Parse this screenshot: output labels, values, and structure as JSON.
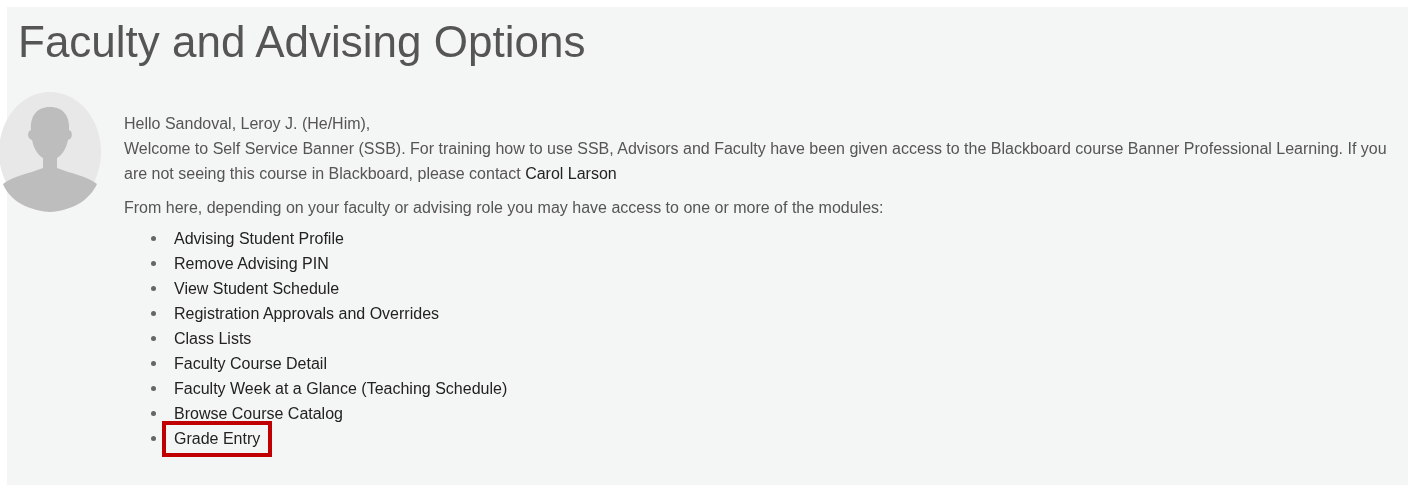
{
  "title": "Faculty and Advising Options",
  "greeting": "Hello Sandoval, Leroy J. (He/Him),",
  "welcome": {
    "text": "Welcome to Self Service Banner (SSB). For training how to use SSB, Advisors and Faculty have been given access to the Blackboard course Banner Professional Learning. If you are not seeing this course in Blackboard, please contact",
    "link": "Carol Larson"
  },
  "intro": "From here, depending on your faculty or advising role you may have access to one or more of the modules:",
  "modules": [
    {
      "label": "Advising Student Profile",
      "highlighted": false
    },
    {
      "label": "Remove Advising PIN",
      "highlighted": false
    },
    {
      "label": "View Student Schedule",
      "highlighted": false
    },
    {
      "label": "Registration Approvals and Overrides",
      "highlighted": false
    },
    {
      "label": "Class Lists",
      "highlighted": false
    },
    {
      "label": "Faculty Course Detail",
      "highlighted": false
    },
    {
      "label": "Faculty Week at a Glance (Teaching Schedule)",
      "highlighted": false
    },
    {
      "label": "Browse Course Catalog",
      "highlighted": false
    },
    {
      "label": "Grade Entry",
      "highlighted": true
    }
  ]
}
